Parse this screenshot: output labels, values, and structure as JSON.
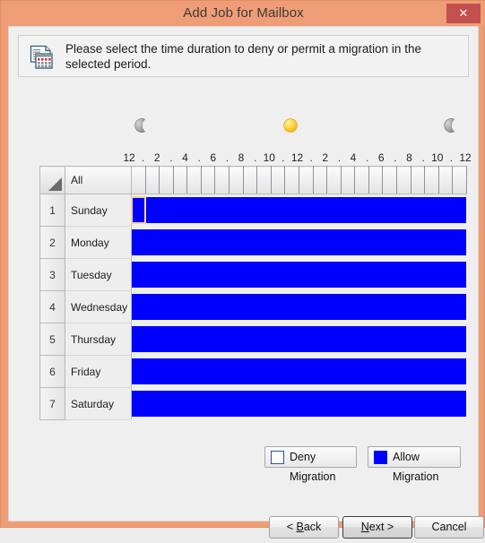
{
  "window": {
    "title": "Add Job for Mailbox",
    "close_label": "✕",
    "titlebar_color": "#ef9d76",
    "close_color": "#c44f4f"
  },
  "banner": {
    "icon": "calendar-document-icon",
    "text": "Please select the time duration to deny or permit a migration in the selected period."
  },
  "daynight": {
    "left_icon": "moon-icon",
    "mid_icon": "sun-icon",
    "right_icon": "moon-icon"
  },
  "ruler": {
    "labels": [
      "12",
      ".",
      "2",
      ".",
      "4",
      ".",
      "6",
      ".",
      "8",
      ".",
      "10",
      ".",
      "12",
      ".",
      "2",
      ".",
      "4",
      ".",
      "6",
      ".",
      "8",
      ".",
      "10",
      ".",
      "12"
    ]
  },
  "grid": {
    "corner_icon": "select-all-triangle-icon",
    "all_label": "All",
    "hours": 24,
    "rows": [
      {
        "number": "1",
        "day": "Sunday"
      },
      {
        "number": "2",
        "day": "Monday"
      },
      {
        "number": "3",
        "day": "Tuesday"
      },
      {
        "number": "4",
        "day": "Wednesday"
      },
      {
        "number": "5",
        "day": "Thursday"
      },
      {
        "number": "6",
        "day": "Friday"
      },
      {
        "number": "7",
        "day": "Saturday"
      }
    ],
    "states": [
      [
        "allow",
        "allow",
        "allow",
        "allow",
        "allow",
        "allow",
        "allow",
        "allow",
        "allow",
        "allow",
        "allow",
        "allow",
        "allow",
        "allow",
        "allow",
        "allow",
        "allow",
        "allow",
        "allow",
        "allow",
        "allow",
        "allow",
        "allow",
        "allow"
      ],
      [
        "allow",
        "allow",
        "allow",
        "allow",
        "allow",
        "allow",
        "allow",
        "allow",
        "allow",
        "allow",
        "allow",
        "allow",
        "allow",
        "allow",
        "allow",
        "allow",
        "allow",
        "allow",
        "allow",
        "allow",
        "allow",
        "allow",
        "allow",
        "allow"
      ],
      [
        "allow",
        "allow",
        "allow",
        "allow",
        "allow",
        "allow",
        "allow",
        "allow",
        "allow",
        "allow",
        "allow",
        "allow",
        "allow",
        "allow",
        "allow",
        "allow",
        "allow",
        "allow",
        "allow",
        "allow",
        "allow",
        "allow",
        "allow",
        "allow"
      ],
      [
        "allow",
        "allow",
        "allow",
        "allow",
        "allow",
        "allow",
        "allow",
        "allow",
        "allow",
        "allow",
        "allow",
        "allow",
        "allow",
        "allow",
        "allow",
        "allow",
        "allow",
        "allow",
        "allow",
        "allow",
        "allow",
        "allow",
        "allow",
        "allow"
      ],
      [
        "allow",
        "allow",
        "allow",
        "allow",
        "allow",
        "allow",
        "allow",
        "allow",
        "allow",
        "allow",
        "allow",
        "allow",
        "allow",
        "allow",
        "allow",
        "allow",
        "allow",
        "allow",
        "allow",
        "allow",
        "allow",
        "allow",
        "allow",
        "allow"
      ],
      [
        "allow",
        "allow",
        "allow",
        "allow",
        "allow",
        "allow",
        "allow",
        "allow",
        "allow",
        "allow",
        "allow",
        "allow",
        "allow",
        "allow",
        "allow",
        "allow",
        "allow",
        "allow",
        "allow",
        "allow",
        "allow",
        "allow",
        "allow",
        "allow"
      ],
      [
        "allow",
        "allow",
        "allow",
        "allow",
        "allow",
        "allow",
        "allow",
        "allow",
        "allow",
        "allow",
        "allow",
        "allow",
        "allow",
        "allow",
        "allow",
        "allow",
        "allow",
        "allow",
        "allow",
        "allow",
        "allow",
        "allow",
        "allow",
        "allow"
      ]
    ],
    "selected_cell": {
      "row": 0,
      "col": 0
    },
    "allow_color": "#0000ff",
    "deny_color": "#ffffff",
    "selection_color": "#f2d49a"
  },
  "legend": {
    "deny_label": "Deny Migration",
    "allow_label": "Allow Migration"
  },
  "buttons": {
    "back": "< Back",
    "next": "Next >",
    "cancel": "Cancel"
  }
}
